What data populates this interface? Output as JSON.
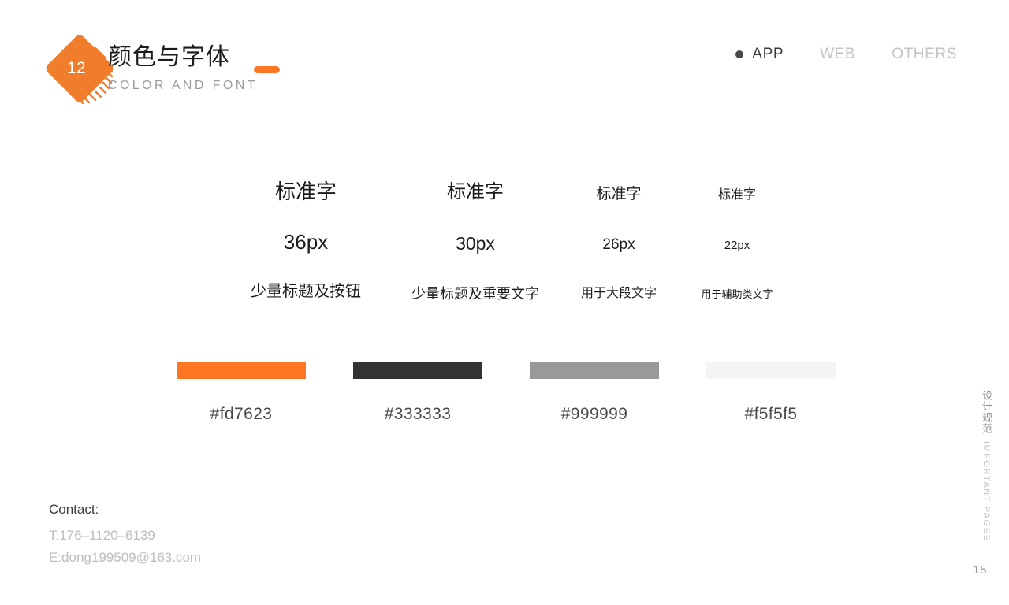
{
  "header": {
    "badge_number": "12",
    "title_cn": "颜色与字体",
    "title_en": "COLOR AND FONT",
    "accent_color": "#fd7623"
  },
  "nav": {
    "items": [
      {
        "label": "APP",
        "active": true
      },
      {
        "label": "WEB",
        "active": false
      },
      {
        "label": "OTHERS",
        "active": false
      }
    ]
  },
  "specimens": {
    "columns": [
      {
        "sample": "标准字",
        "size": "36px",
        "usage": "少量标题及按钮"
      },
      {
        "sample": "标准字",
        "size": "30px",
        "usage": "少量标题及重要文字"
      },
      {
        "sample": "标准字",
        "size": "26px",
        "usage": "用于大段文字"
      },
      {
        "sample": "标准字",
        "size": "22px",
        "usage": "用于辅助类文字"
      }
    ]
  },
  "palette": {
    "swatches": [
      {
        "hex": "#fd7623",
        "label": "#fd7623"
      },
      {
        "hex": "#333333",
        "label": "#333333"
      },
      {
        "hex": "#999999",
        "label": "#999999"
      },
      {
        "hex": "#f5f5f5",
        "label": "#f5f5f5"
      }
    ]
  },
  "contact": {
    "title": "Contact:",
    "phone": "T:176–1120–6139",
    "email": "E:dong199509@163.com"
  },
  "side_label": {
    "cn": "设计规范",
    "en": "IMPORTANT PAGES"
  },
  "footer": {
    "page_number": "15"
  }
}
